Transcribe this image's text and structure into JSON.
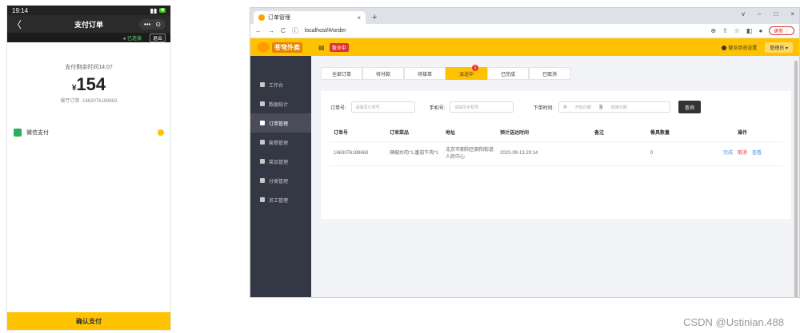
{
  "phone": {
    "status_time": "19:14",
    "nav_back": "〈",
    "nav_title": "支付订单",
    "capsule_more": "•••",
    "capsule_close": "⊙",
    "sub_online": "● 已连接",
    "sub_exit": "退出",
    "time_left": "支付剩余时间14:07",
    "currency": "¥",
    "amount": "154",
    "order_no": "餐厅订单 -1663076189663",
    "pay_method": "微信支付",
    "confirm_btn": "确认支付"
  },
  "browser": {
    "tab_title": "订单管理",
    "tab_close": "×",
    "new_tab": "+",
    "win_controls": [
      "v",
      "–",
      "□",
      "×"
    ],
    "nav_back": "←",
    "nav_forward": "→",
    "nav_reload": "C",
    "url_info_icon": "ⓘ",
    "url": "localhost/#/order",
    "update_btn": "更新 ⋮"
  },
  "app": {
    "logo_text": "苍穹外卖",
    "shop_status": "营业中",
    "right_status": "营业状态设置",
    "admin": "管理员",
    "sidebar": [
      {
        "label": "工作台",
        "active": false
      },
      {
        "label": "数据统计",
        "active": false
      },
      {
        "label": "订单管理",
        "active": true
      },
      {
        "label": "套餐管理",
        "active": false
      },
      {
        "label": "菜品管理",
        "active": false
      },
      {
        "label": "分类管理",
        "active": false
      },
      {
        "label": "员工管理",
        "active": false
      }
    ],
    "order_tabs": [
      {
        "label": "全部订单",
        "active": false,
        "badge": ""
      },
      {
        "label": "待付款",
        "active": false,
        "badge": ""
      },
      {
        "label": "待接单",
        "active": false,
        "badge": ""
      },
      {
        "label": "派送中",
        "active": true,
        "badge": "1"
      },
      {
        "label": "已完成",
        "active": false,
        "badge": ""
      },
      {
        "label": "已取消",
        "active": false,
        "badge": ""
      }
    ],
    "filters": {
      "order_no_label": "订单号:",
      "order_no_placeholder": "请填写订单号",
      "phone_label": "手机号:",
      "phone_placeholder": "请填写手机号",
      "time_label": "下单时间:",
      "time_start": "开始日期",
      "time_sep": "至",
      "time_end": "结束日期",
      "query_btn": "查询"
    },
    "table": {
      "headers": [
        "订单号",
        "订单菜品",
        "地址",
        "预计送达时间",
        "备注",
        "餐具数量",
        "操作"
      ],
      "rows": [
        {
          "order_no": "1663076189663",
          "dishes": "辣椒炒肉*1,番茄牛肉*1",
          "address": "北京市朝阳区朝阳街道人民中心",
          "eta": "2022-09-13 20:14",
          "remark": "",
          "tableware": "0",
          "op_accept": "完成",
          "op_reject": "取消",
          "op_detail": "查看"
        }
      ]
    }
  },
  "watermark": "CSDN @Ustinian.488"
}
